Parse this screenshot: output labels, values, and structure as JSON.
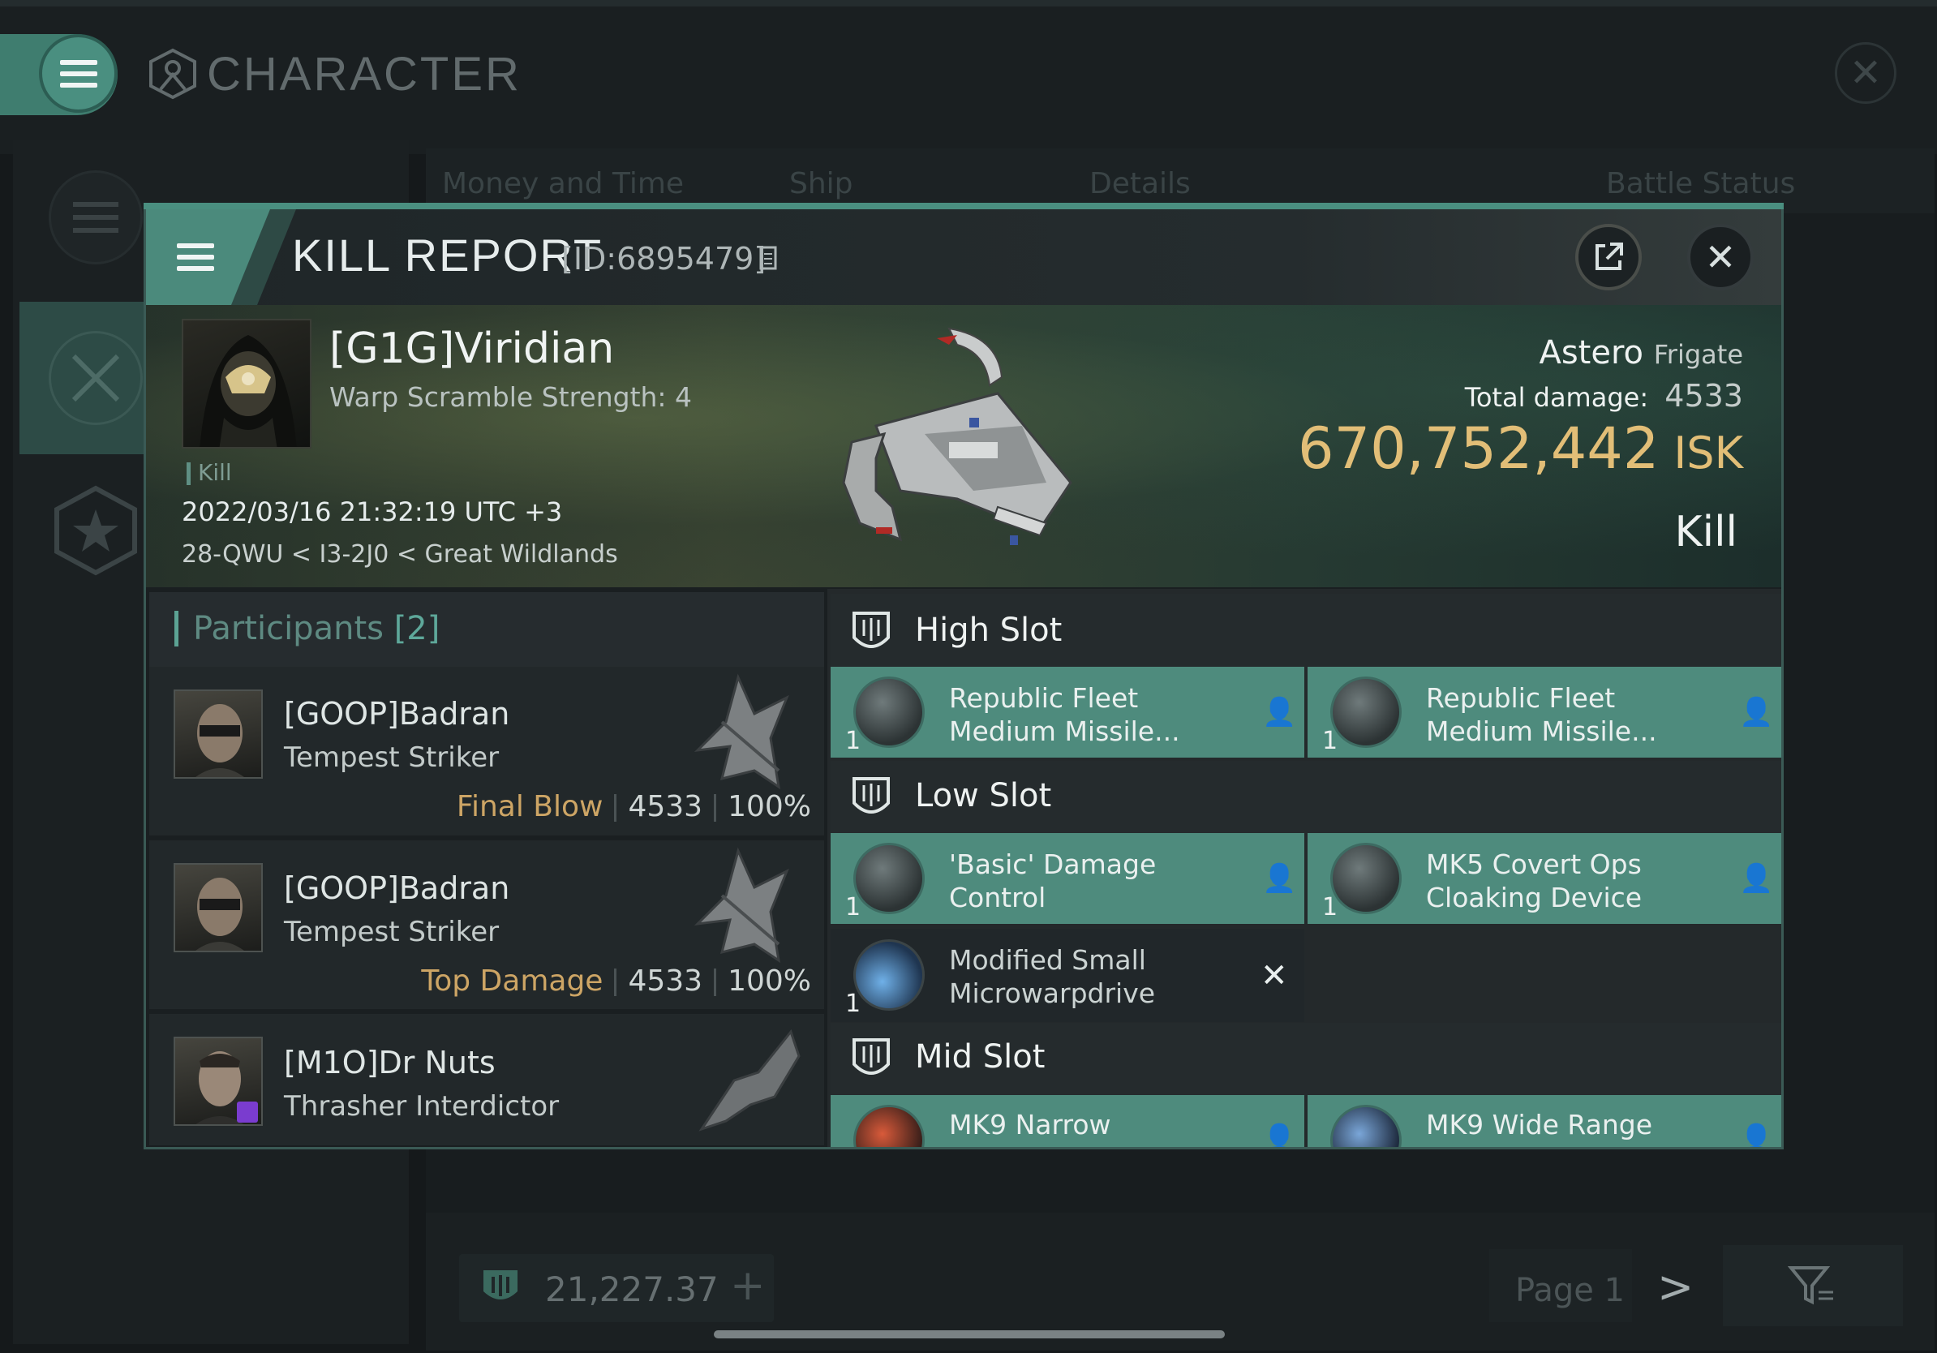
{
  "window": {
    "title": "CHARACTER"
  },
  "background_tabs": [
    "Money and Time",
    "Ship",
    "Details",
    "Battle Status"
  ],
  "bottom_bar": {
    "isk": "21,227.37",
    "page": "Page 1"
  },
  "kill_report": {
    "title": "KILL REPORT",
    "id": "[ID:6895479]",
    "victim": {
      "name": "[G1G]Viridian",
      "warp_scramble": "Warp Scramble Strength: 4",
      "tag": "Kill",
      "datetime": "2022/03/16 21:32:19 UTC +3",
      "location": "28-QWU < I3-2J0 < Great Wildlands"
    },
    "ship": {
      "name": "Astero",
      "class": "Frigate"
    },
    "total_damage_label": "Total damage:",
    "total_damage": "4533",
    "isk_value": "670,752,442",
    "isk_unit": "ISK",
    "status": "Kill"
  },
  "participants": {
    "label": "Participants",
    "count": "[2]",
    "items": [
      {
        "name": "[GOOP]Badran",
        "ship": "Tempest Striker",
        "role": "Final Blow",
        "damage": "4533",
        "percent": "100%"
      },
      {
        "name": "[GOOP]Badran",
        "ship": "Tempest Striker",
        "role": "Top Damage",
        "damage": "4533",
        "percent": "100%"
      },
      {
        "name": "[M1O]Dr Nuts",
        "ship": "Thrasher Interdictor"
      }
    ]
  },
  "fitting": {
    "high_slot": {
      "label": "High Slot",
      "modules": [
        {
          "qty": "1",
          "name_line1": "Republic Fleet",
          "name_line2": "Medium Missile..."
        },
        {
          "qty": "1",
          "name_line1": "Republic Fleet",
          "name_line2": "Medium Missile..."
        }
      ]
    },
    "low_slot": {
      "label": "Low Slot",
      "modules": [
        {
          "qty": "1",
          "name_line1": "'Basic' Damage",
          "name_line2": "Control"
        },
        {
          "qty": "1",
          "name_line1": "MK5 Covert Ops",
          "name_line2": "Cloaking Device"
        },
        {
          "qty": "1",
          "name_line1": "Modified Small",
          "name_line2": "Microwarpdrive"
        }
      ]
    },
    "mid_slot": {
      "label": "Mid Slot",
      "modules": [
        {
          "name_line1": "MK9 Narrow"
        },
        {
          "name_line1": "MK9 Wide Range"
        }
      ]
    }
  },
  "colors": {
    "accent": "#4e8b7d",
    "isk": "#e2be77",
    "role_label": "#cda565"
  }
}
